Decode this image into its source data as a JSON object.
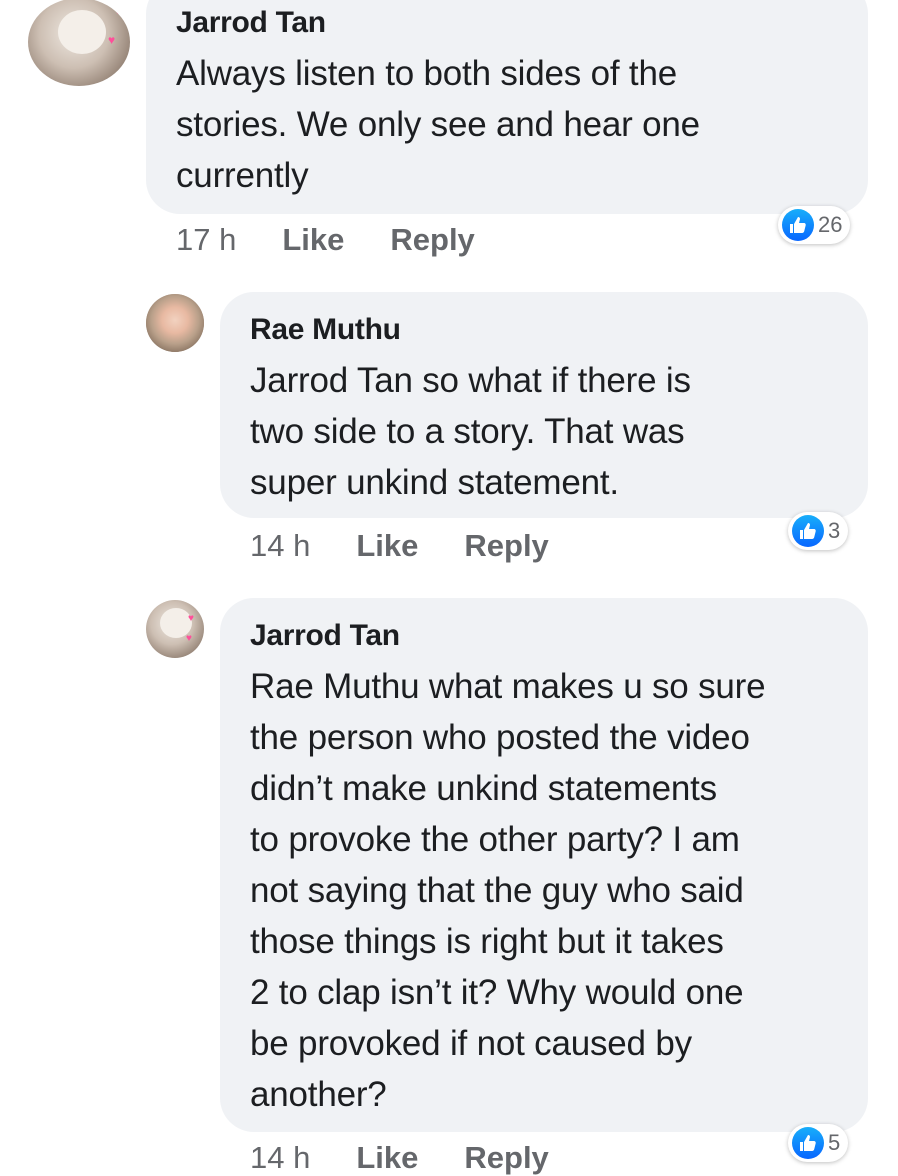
{
  "comments": [
    {
      "author": "Jarrod Tan",
      "lines": [
        "Always listen to both sides of the",
        "stories. We only see and hear one",
        "currently"
      ],
      "time": "17 h",
      "like_label": "Like",
      "reply_label": "Reply",
      "reaction_count": "26",
      "reaction_icon": "thumbs-up-icon"
    },
    {
      "author": "Rae Muthu",
      "lines": [
        "Jarrod Tan so what if there is",
        "two side to a story. That was",
        "super unkind statement."
      ],
      "time": "14 h",
      "like_label": "Like",
      "reply_label": "Reply",
      "reaction_count": "3",
      "reaction_icon": "thumbs-up-icon"
    },
    {
      "author": "Jarrod Tan",
      "lines": [
        "Rae Muthu what makes u so sure",
        "the person who posted the video",
        "didn’t make unkind statements",
        "to provoke the other party? I am",
        "not saying that the guy who said",
        "those things is right but it takes",
        "2 to clap isn’t it? Why would one",
        "be provoked if not caused by",
        "another?"
      ],
      "time": "14 h",
      "like_label": "Like",
      "reply_label": "Reply",
      "reaction_count": "5",
      "reaction_icon": "thumbs-up-icon"
    }
  ],
  "colors": {
    "bubble": "#f0f2f5",
    "meta_text": "#65676b",
    "like_blue": "#0866ff",
    "avatar_heart": "#ff4f9a"
  }
}
